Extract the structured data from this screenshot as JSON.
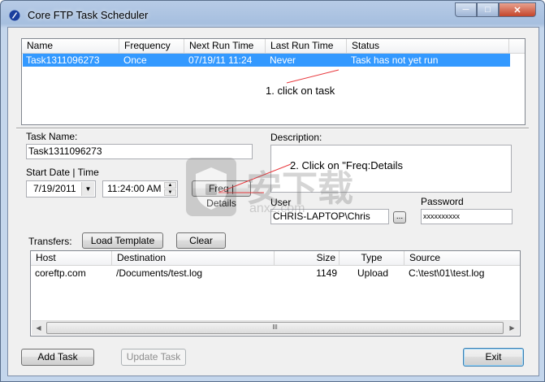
{
  "window": {
    "title": "Core FTP Task Scheduler"
  },
  "tasks": {
    "columns": [
      "Name",
      "Frequency",
      "Next Run Time",
      "Last Run Time",
      "Status"
    ],
    "rows": [
      {
        "name": "Task1311096273",
        "frequency": "Once",
        "next_run": "07/19/11  11:24",
        "last_run": "Never",
        "status": "Task has not yet run",
        "selected": true
      }
    ]
  },
  "annotations": {
    "step1": "1.  click on task",
    "step2": "2.  Click on \"Freq:Details"
  },
  "form": {
    "task_name_label": "Task Name:",
    "task_name_value": "Task1311096273",
    "start_label": "Start Date | Time",
    "date_value": "7/19/2011",
    "time_value": "11:24:00 AM",
    "freq_button": "Freq | Details",
    "description_label": "Description:",
    "description_value": "",
    "user_label": "User",
    "user_value": "CHRIS-LAPTOP\\Chris",
    "browse_button": "...",
    "password_label": "Password",
    "password_value": "xxxxxxxxxx"
  },
  "transfers": {
    "label": "Transfers:",
    "load_template": "Load Template",
    "clear": "Clear",
    "columns": [
      "Host",
      "Destination",
      "Size",
      "Type",
      "Source"
    ],
    "rows": [
      {
        "host": "coreftp.com",
        "destination": "/Documents/test.log",
        "size": "1149",
        "type": "Upload",
        "source": "C:\\test\\01\\test.log"
      }
    ]
  },
  "footer": {
    "add_task": "Add Task",
    "update_task": "Update Task",
    "exit": "Exit"
  },
  "colors": {
    "selection": "#3399ff",
    "title_bar": "#a6bfdf",
    "annotation_line": "#e8383d"
  },
  "watermark": {
    "text": "安下载",
    "subtext": "anxz.com"
  }
}
